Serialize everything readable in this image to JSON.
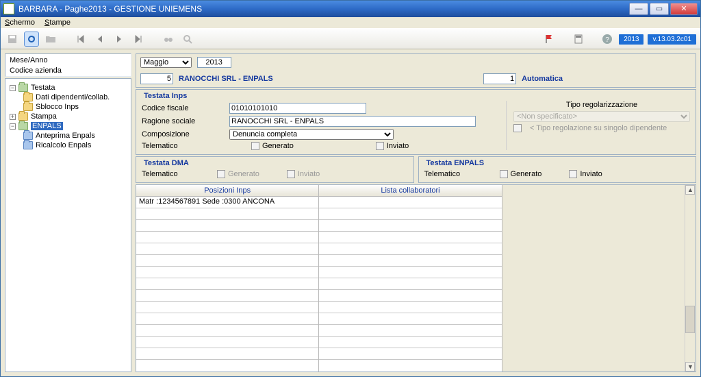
{
  "window": {
    "title": "BARBARA - Paghe2013 - GESTIONE UNIEMENS"
  },
  "menu": {
    "schermo": "Schermo",
    "stampe": "Stampe"
  },
  "toolbar": {
    "year_badge": "2013",
    "version_badge": "v.13.03.2c01"
  },
  "left": {
    "mese_anno_label": "Mese/Anno",
    "codice_azienda_label": "Codice azienda"
  },
  "tree": {
    "testata": "Testata",
    "dati_dip": "Dati dipendenti/collab.",
    "sblocco_inps": "Sblocco Inps",
    "stampa": "Stampa",
    "enpals": "ENPALS",
    "anteprima_enpals": "Anteprima Enpals",
    "ricalcolo_enpals": "Ricalcolo Enpals"
  },
  "top": {
    "month": "Maggio",
    "year": "2013",
    "codice_azienda_value": "5",
    "company_name": "RANOCCHI SRL - ENPALS",
    "seq_value": "1",
    "seq_label": "Automatica"
  },
  "inps": {
    "legend": "Testata Inps",
    "codice_fiscale_label": "Codice fiscale",
    "codice_fiscale_value": "01010101010",
    "ragione_sociale_label": "Ragione sociale",
    "ragione_sociale_value": "RANOCCHI SRL - ENPALS",
    "composizione_label": "Composizione",
    "composizione_value": "Denuncia completa",
    "telematico_label": "Telematico",
    "generato_label": "Generato",
    "inviato_label": "Inviato",
    "tipo_reg_label": "Tipo regolarizzazione",
    "tipo_reg_value": "<Non specificato>",
    "tipo_reg_note": "< Tipo regolazione su singolo dipendente"
  },
  "dma": {
    "legend": "Testata DMA",
    "telematico_label": "Telematico",
    "generato_label": "Generato",
    "inviato_label": "Inviato"
  },
  "enpals": {
    "legend": "Testata ENPALS",
    "telematico_label": "Telematico",
    "generato_label": "Generato",
    "inviato_label": "Inviato"
  },
  "table": {
    "col1_header": "Posizioni Inps",
    "col2_header": "Lista collaboratori",
    "row1": "Matr :1234567891 Sede :0300 ANCONA"
  }
}
